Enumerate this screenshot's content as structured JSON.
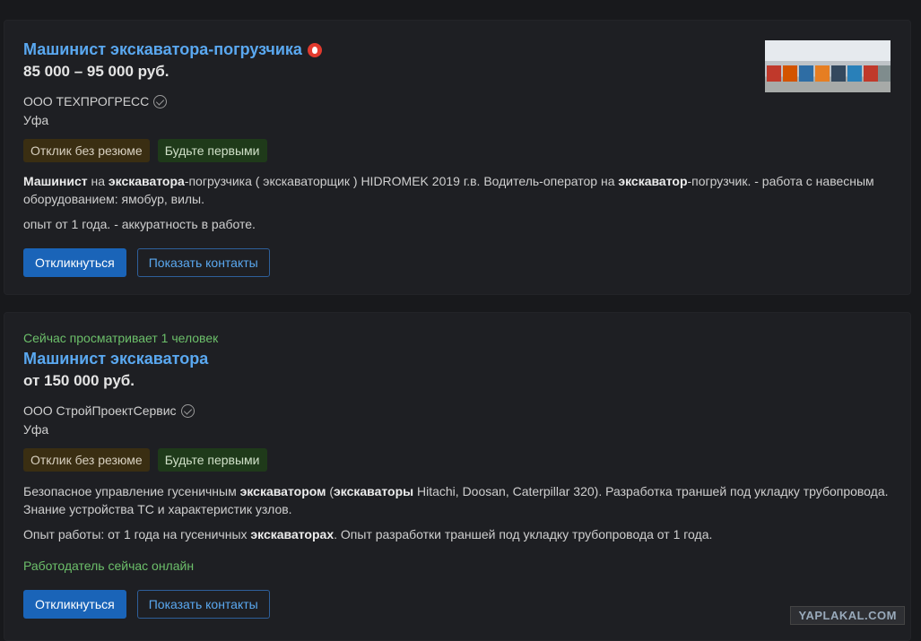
{
  "cards": [
    {
      "title": "Машинист экскаватора-погрузчика",
      "salary": "85 000 – 95 000 руб.",
      "company": "ООО ТЕХПРОГРЕСС",
      "city": "Уфа",
      "badge_resume": "Отклик без резюме",
      "badge_first": "Будьте первыми",
      "desc1": {
        "p1": "Машинист",
        "p2": " на ",
        "p3": "экскаватора",
        "p4": "-погрузчика ( экскаваторщик ) HIDROMEK 2019 г.в. Водитель-оператор на ",
        "p5": "экскаватор",
        "p6": "-погрузчик. - работа с навесным оборудованием: ямобур, вилы."
      },
      "desc2": "опыт от 1 года. - аккуратность в работе.",
      "apply_label": "Откликнуться",
      "contacts_label": "Показать контакты"
    },
    {
      "viewing": "Сейчас просматривает 1 человек",
      "title": "Машинист экскаватора",
      "salary": "от 150 000 руб.",
      "company": "ООО СтройПроектСервис",
      "city": "Уфа",
      "badge_resume": "Отклик без резюме",
      "badge_first": "Будьте первыми",
      "desc1": {
        "p1": "Безопасное управление гусеничным ",
        "p2": "экскаватором",
        "p3": " (",
        "p4": "экскаваторы",
        "p5": " Hitachi, Doosan, Caterpillar 320). Разработка траншей под укладку трубопровода. Знание устройства ТС и характеристик узлов."
      },
      "desc2": {
        "p1": "Опыт работы: от 1 года на гусеничных ",
        "p2": "экскаваторах",
        "p3": ". Опыт разработки траншей под укладку трубопровода от 1 года."
      },
      "online": "Работодатель сейчас онлайн",
      "apply_label": "Откликнуться",
      "contacts_label": "Показать контакты"
    }
  ],
  "watermark": "YAPLAKAL.COM",
  "colors": {
    "background": "#18191c",
    "card": "#1e1f23",
    "link": "#5aa8f0",
    "primary_button": "#1a64b8",
    "online_green": "#6cbf6a"
  }
}
